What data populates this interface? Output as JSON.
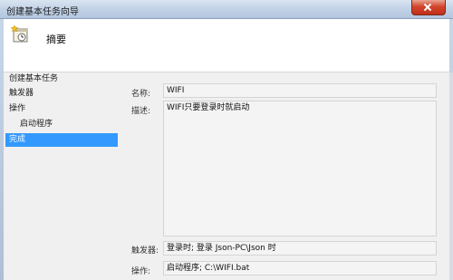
{
  "window": {
    "title": "创建基本任务向导"
  },
  "header": {
    "title": "摘要",
    "icon": "task-wizard-icon"
  },
  "nav": {
    "items": [
      {
        "label": "创建基本任务"
      },
      {
        "label": "触发器"
      },
      {
        "label": "操作"
      },
      {
        "label": "启动程序"
      },
      {
        "label": "完成"
      }
    ],
    "selected_index": 4
  },
  "summary": {
    "name_label": "名称:",
    "name_value": "WIFI",
    "description_label": "描述:",
    "description_value": "WIFI只要登录时就启动",
    "trigger_label": "触发器:",
    "trigger_value": "登录时; 登录 Json-PC\\Json 时",
    "action_label": "操作:",
    "action_value": "启动程序; C:\\WIFI.bat"
  },
  "colors": {
    "selection": "#3399ff",
    "close_button": "#c0301a"
  }
}
